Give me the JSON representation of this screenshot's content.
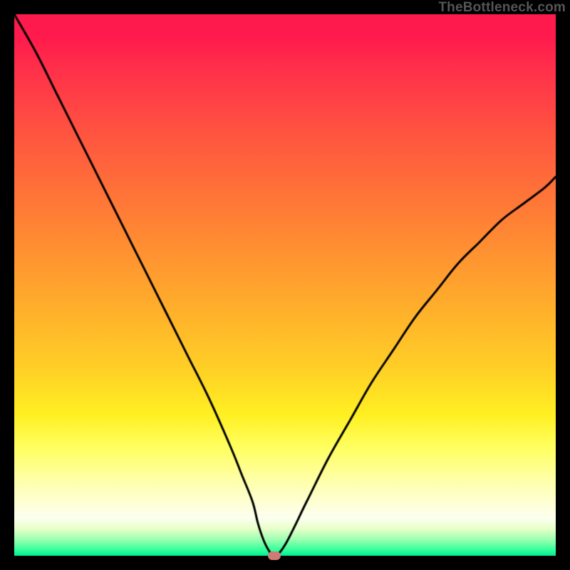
{
  "watermark": {
    "text": "TheBottleneck.com"
  },
  "colors": {
    "curve": "#000000",
    "dot": "#cd7b74",
    "gradient_top": "#ff1a4d",
    "gradient_bottom": "#00ed95"
  },
  "chart_data": {
    "type": "line",
    "title": "",
    "xlabel": "",
    "ylabel": "",
    "xlim": [
      0,
      100
    ],
    "ylim": [
      0,
      100
    ],
    "grid": false,
    "series": [
      {
        "name": "bottleneck-curve",
        "x": [
          0,
          4,
          8,
          12,
          16,
          20,
          24,
          28,
          32,
          36,
          40,
          42,
          44,
          45,
          46,
          47,
          48,
          50,
          54,
          58,
          62,
          66,
          70,
          74,
          78,
          82,
          86,
          90,
          94,
          98,
          100
        ],
        "y": [
          100,
          93,
          85,
          77,
          69,
          61,
          53,
          45,
          37,
          29,
          20,
          15,
          10,
          6,
          3,
          1,
          0,
          2,
          10,
          18,
          25,
          32,
          38,
          44,
          49,
          54,
          58,
          62,
          65,
          68,
          70
        ]
      }
    ],
    "minimum": {
      "x": 48,
      "y": 0
    },
    "annotations": []
  }
}
